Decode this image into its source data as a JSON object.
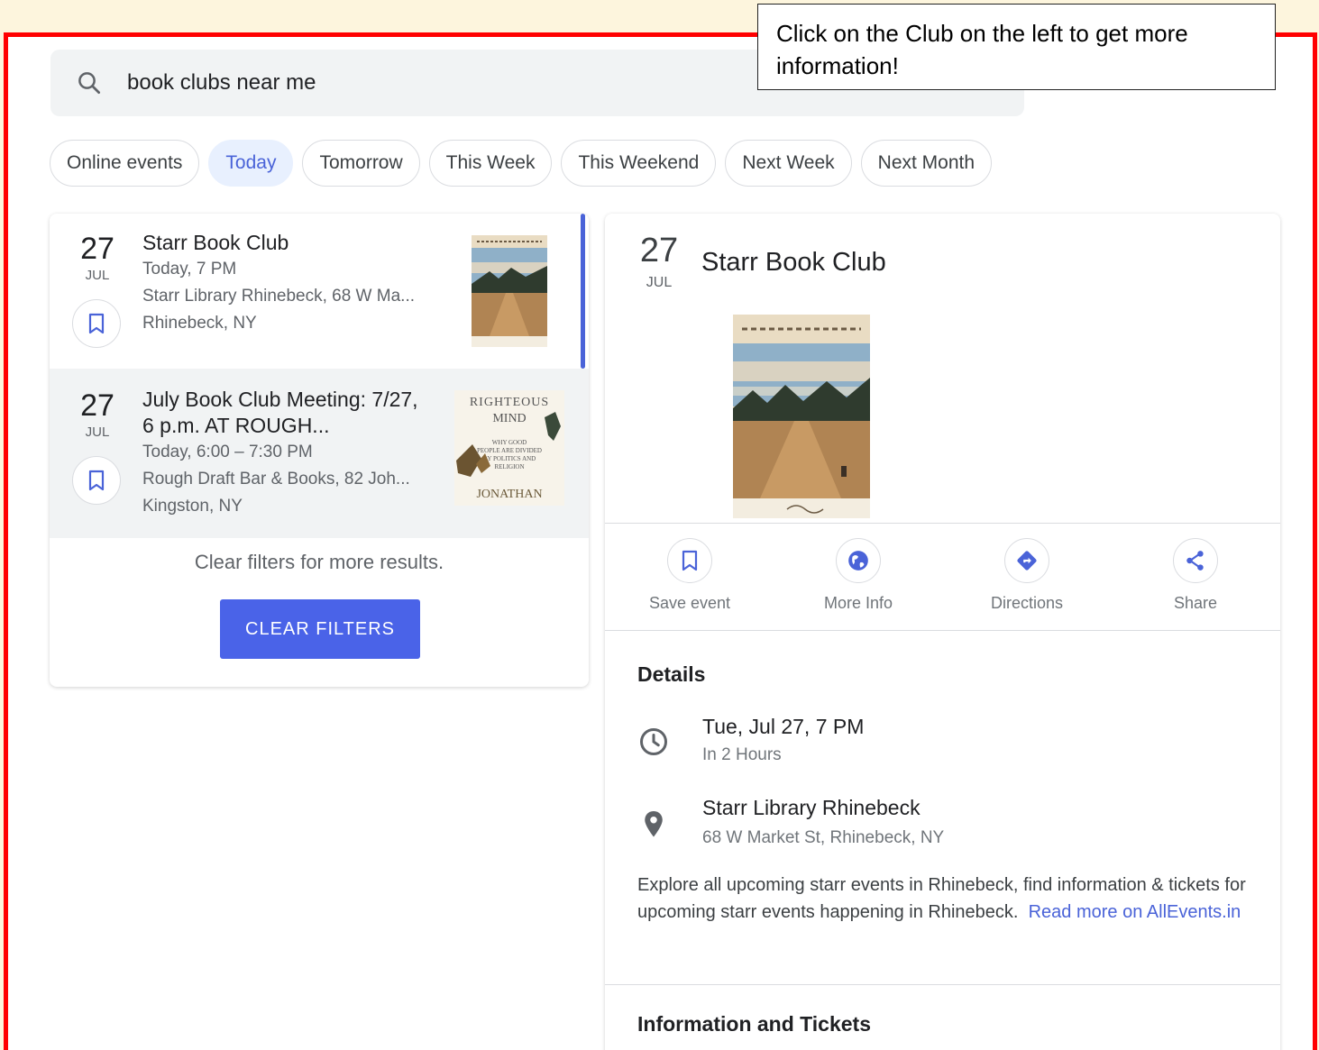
{
  "callout": {
    "text": "Click on the Club on the left to get more information!"
  },
  "search": {
    "query": "book clubs near me",
    "icon": "search-icon"
  },
  "chips": [
    "Online events",
    "Today",
    "Tomorrow",
    "This Week",
    "This Weekend",
    "Next Week",
    "Next Month"
  ],
  "active_chip": "Today",
  "events": [
    {
      "day": "27",
      "month": "JUL",
      "title": "Starr Book Club",
      "time": "Today, 7 PM",
      "venue": "Starr Library Rhinebeck, 68 W Ma...",
      "city": "Rhinebeck, NY",
      "selected": true
    },
    {
      "day": "27",
      "month": "JUL",
      "title_line1": "July Book Club Meeting: 7/27,",
      "title_line2": "6 p.m. AT ROUGH...",
      "time": "Today, 6:00 – 7:30 PM",
      "venue": "Rough Draft Bar & Books, 82 Joh...",
      "city": "Kingston, NY",
      "cover": {
        "line1": "RIGHTEOUS",
        "line2": "MIND",
        "line3": "WHY GOOD",
        "line4": "PEOPLE ARE DIVIDED",
        "line5": "BY POLITICS AND",
        "line6": "RELIGION",
        "author": "JONATHAN"
      }
    }
  ],
  "list_footer": {
    "message": "Clear filters for more results.",
    "button": "CLEAR FILTERS"
  },
  "detail": {
    "day": "27",
    "month": "JUL",
    "title": "Starr Book Club",
    "actions": [
      {
        "label": "Save event",
        "icon": "bookmark-icon"
      },
      {
        "label": "More Info",
        "icon": "globe-icon"
      },
      {
        "label": "Directions",
        "icon": "directions-icon"
      },
      {
        "label": "Share",
        "icon": "share-icon"
      }
    ],
    "details_heading": "Details",
    "when_main": "Tue, Jul 27, 7 PM",
    "when_sub": "In 2 Hours",
    "where_main": "Starr Library Rhinebeck",
    "where_sub": "68 W Market St, Rhinebeck, NY",
    "description": "Explore all upcoming starr events in Rhinebeck, find information & tickets for upcoming starr events happening in Rhinebeck.",
    "read_more": "Read more on AllEvents.in",
    "tickets_heading": "Information and Tickets"
  },
  "colors": {
    "accent": "#4a63d8",
    "button": "#4a63e8",
    "frame": "#ff0000",
    "background": "#fdf5dd"
  }
}
